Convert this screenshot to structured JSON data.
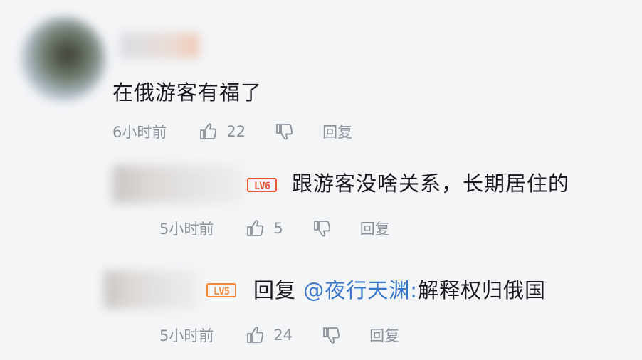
{
  "main_comment": {
    "text": "在俄游客有福了",
    "time": "6小时前",
    "likes": "22",
    "reply_label": "回复"
  },
  "replies": [
    {
      "level": "LV6",
      "text": "跟游客没啥关系，长期居住的",
      "time": "5小时前",
      "likes": "5",
      "reply_label": "回复"
    },
    {
      "level": "LV5",
      "prefix": "回复",
      "mention": "@夜行天渊",
      "colon": ":",
      "text": "解释权归俄国",
      "time": "5小时前",
      "likes": "24",
      "reply_label": "回复"
    }
  ],
  "icons": {
    "like": "thumbs-up-icon",
    "dislike": "thumbs-down-icon"
  },
  "colors": {
    "background": "#f4f5f7",
    "meta_text": "#8a8f99",
    "mention": "#3b77c9",
    "lv6_badge": "#e8593a",
    "lv5_badge": "#f08a3a"
  }
}
